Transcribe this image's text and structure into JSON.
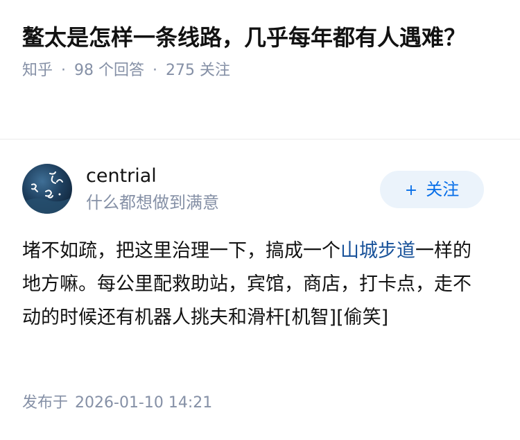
{
  "question": {
    "title": "鳌太是怎样一条线路，几乎每年都有人遇难？",
    "source": "知乎",
    "answer_count": "98",
    "answer_unit": "个回答",
    "follower_count": "275",
    "follower_unit": "关注",
    "separator": "·"
  },
  "author": {
    "name": "centrial",
    "bio": "什么都想做到满意",
    "follow_plus": "+",
    "follow_label": "关注"
  },
  "answer": {
    "text_before": "堵不如疏，把这里治理一下，搞成一个",
    "link_text": "山城步道",
    "text_after": "一样的地方嘛。每公里配救助站，宾馆，商店，打卡点，走不动的时候还有机器人挑夫和滑杆[机智][偷笑]"
  },
  "publish": {
    "label": "发布于",
    "time": "2026-01-10 14:21"
  },
  "colors": {
    "meta_gray": "#8590a6",
    "link_blue": "#175199",
    "follow_blue": "#056de8",
    "follow_bg": "#ebf3fb"
  }
}
